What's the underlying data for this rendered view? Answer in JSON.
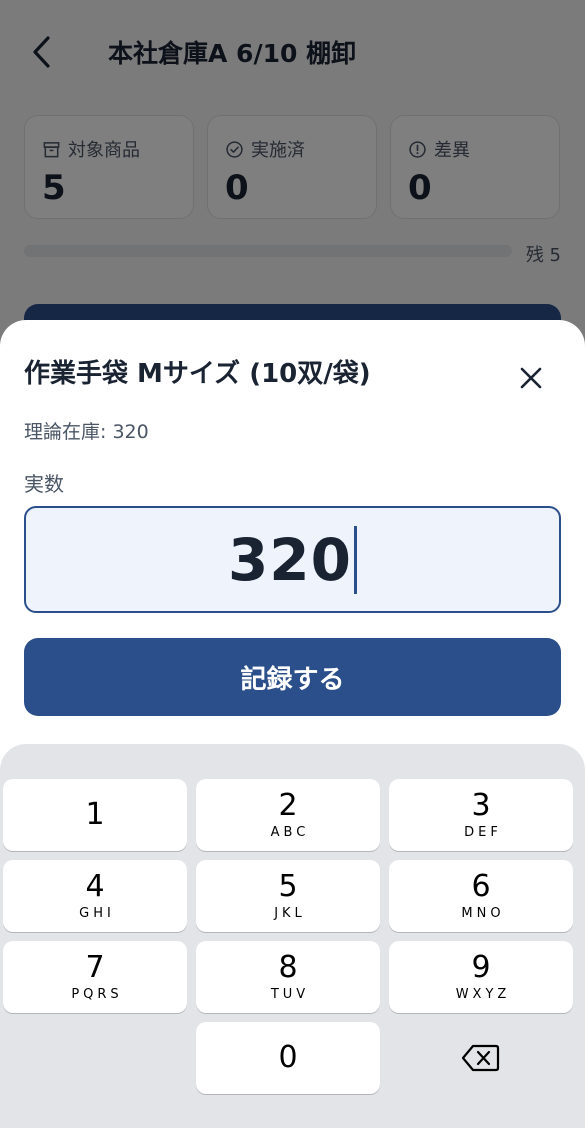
{
  "header": {
    "title": "本社倉庫A 6/10 棚卸",
    "back_icon": "chevron-left-icon"
  },
  "stats": [
    {
      "label": "対象商品",
      "value": "5",
      "icon": "box-icon"
    },
    {
      "label": "実施済",
      "value": "0",
      "icon": "check-circle-icon"
    },
    {
      "label": "差異",
      "value": "0",
      "icon": "alert-circle-icon"
    }
  ],
  "progress": {
    "rest_label": "残 5",
    "fraction_done": 0
  },
  "sheet": {
    "title": "作業手袋 Mサイズ (10双/袋)",
    "theory_stock": "理論在庫: 320",
    "field_label": "実数",
    "count_value": "320",
    "record_label": "記録する",
    "close_icon": "close-icon"
  },
  "keypad": {
    "keys": [
      {
        "digit": "1",
        "letters": ""
      },
      {
        "digit": "2",
        "letters": "ABC"
      },
      {
        "digit": "3",
        "letters": "DEF"
      },
      {
        "digit": "4",
        "letters": "GHI"
      },
      {
        "digit": "5",
        "letters": "JKL"
      },
      {
        "digit": "6",
        "letters": "MNO"
      },
      {
        "digit": "7",
        "letters": "PQRS"
      },
      {
        "digit": "8",
        "letters": "TUV"
      },
      {
        "digit": "9",
        "letters": "WXYZ"
      },
      {
        "digit": "0",
        "letters": ""
      }
    ],
    "delete_icon": "backspace-icon"
  },
  "colors": {
    "accent": "#2b4f8a",
    "input_bg": "#eef3fc",
    "keypad_bg": "#e3e4e7"
  }
}
